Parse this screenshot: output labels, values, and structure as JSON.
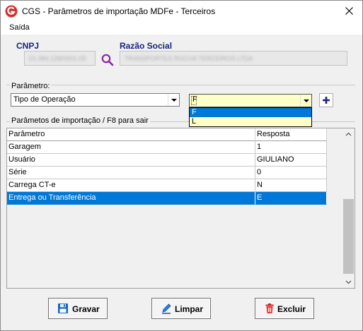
{
  "window": {
    "title": "CGS - Parâmetros de importação MDFe - Terceiros"
  },
  "menu": {
    "items": [
      "Saída"
    ]
  },
  "fields": {
    "cnpj_label": "CNPJ",
    "cnpj_value": "01.084.128/0001-05",
    "razao_label": "Razão Social",
    "razao_value": "TRANSPORTES ROCHA TERCEIROS LTDA"
  },
  "parametro": {
    "label": "Parâmetro:",
    "selected": "Tipo de Operação",
    "value_selected": "F",
    "options": [
      "F",
      "L"
    ],
    "highlighted_option": "F"
  },
  "grid": {
    "group_label": "Parâmetos de importação /  F8 para sair",
    "columns": [
      "Parâmetro",
      "Resposta"
    ],
    "rows": [
      [
        "Garagem",
        "1"
      ],
      [
        "Usuário",
        "GIULIANO"
      ],
      [
        "Série",
        "0"
      ],
      [
        "Carrega CT-e",
        "N"
      ],
      [
        "Entrega ou Transferência",
        "E"
      ]
    ],
    "selected_row_index": 4
  },
  "buttons": {
    "save": "Gravar",
    "clear": "Limpar",
    "delete": "Excluir"
  },
  "colors": {
    "label_blue": "#1a237e",
    "selection_blue": "#0078d7",
    "combo_yellow": "#ffffc8",
    "brand_red": "#d32f2f"
  }
}
